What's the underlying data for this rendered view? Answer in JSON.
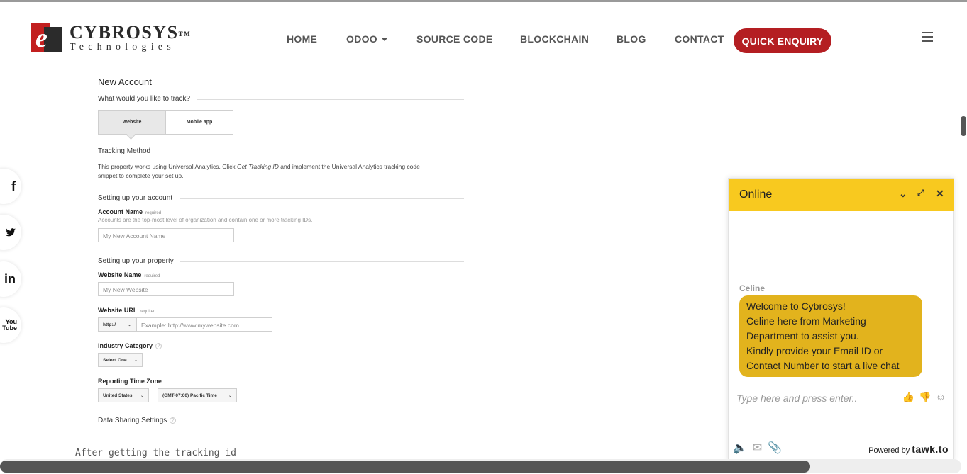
{
  "header": {
    "logo_name": "CYBROSYS",
    "logo_tm": "TM",
    "logo_sub": "Technologies",
    "nav": [
      {
        "label": "HOME"
      },
      {
        "label": "ODOO"
      },
      {
        "label": "SOURCE CODE"
      },
      {
        "label": "BLOCKCHAIN"
      },
      {
        "label": "BLOG"
      },
      {
        "label": "CONTACT"
      }
    ],
    "enquiry_label": "QUICK ENQUIRY"
  },
  "social": [
    {
      "label": "f",
      "icon": "facebook-icon"
    },
    {
      "label": "🐦",
      "icon": "twitter-icon"
    },
    {
      "label": "in",
      "icon": "linkedin-icon"
    },
    {
      "label": "You\nTube",
      "icon": "youtube-icon"
    }
  ],
  "analytics_form": {
    "title": "New Account",
    "track_question": "What would you like to track?",
    "tabs": [
      "Website",
      "Mobile app"
    ],
    "tracking_method_heading": "Tracking Method",
    "tracking_text_1": "This property works using Universal Analytics. Click ",
    "tracking_text_em": "Get Tracking ID",
    "tracking_text_2": " and implement the Universal Analytics tracking code",
    "tracking_text_3": "snippet to complete your set up.",
    "account_heading": "Setting up your account",
    "account_name_label": "Account Name",
    "required": "required",
    "account_hint": "Accounts are the top-most level of organization and contain one or more tracking IDs.",
    "account_placeholder": "My New Account Name",
    "property_heading": "Setting up your property",
    "website_name_label": "Website Name",
    "website_placeholder": "My New Website",
    "website_url_label": "Website URL",
    "protocol": "http://",
    "url_placeholder": "Example: http://www.mywebsite.com",
    "industry_label": "Industry Category",
    "industry_value": "Select One",
    "timezone_label": "Reporting Time Zone",
    "country_value": "United States",
    "timezone_value": "(GMT-07:00) Pacific Time",
    "data_sharing_heading": "Data Sharing Settings"
  },
  "body_text": "After getting the tracking id",
  "chat": {
    "status": "Online",
    "agent_name": "Celine",
    "message_lines": [
      "Welcome to Cybrosys!",
      "Celine here from Marketing",
      "Department to assist you.",
      "Kindly provide your Email ID or",
      "Contact Number to start a live chat"
    ],
    "input_placeholder": "Type here and press enter..",
    "powered_by": "Powered by",
    "brand": "tawk.to"
  },
  "colors": {
    "brand_red": "#b41e22",
    "chat_yellow": "#f8c91f",
    "bubble": "#e2b31d"
  }
}
